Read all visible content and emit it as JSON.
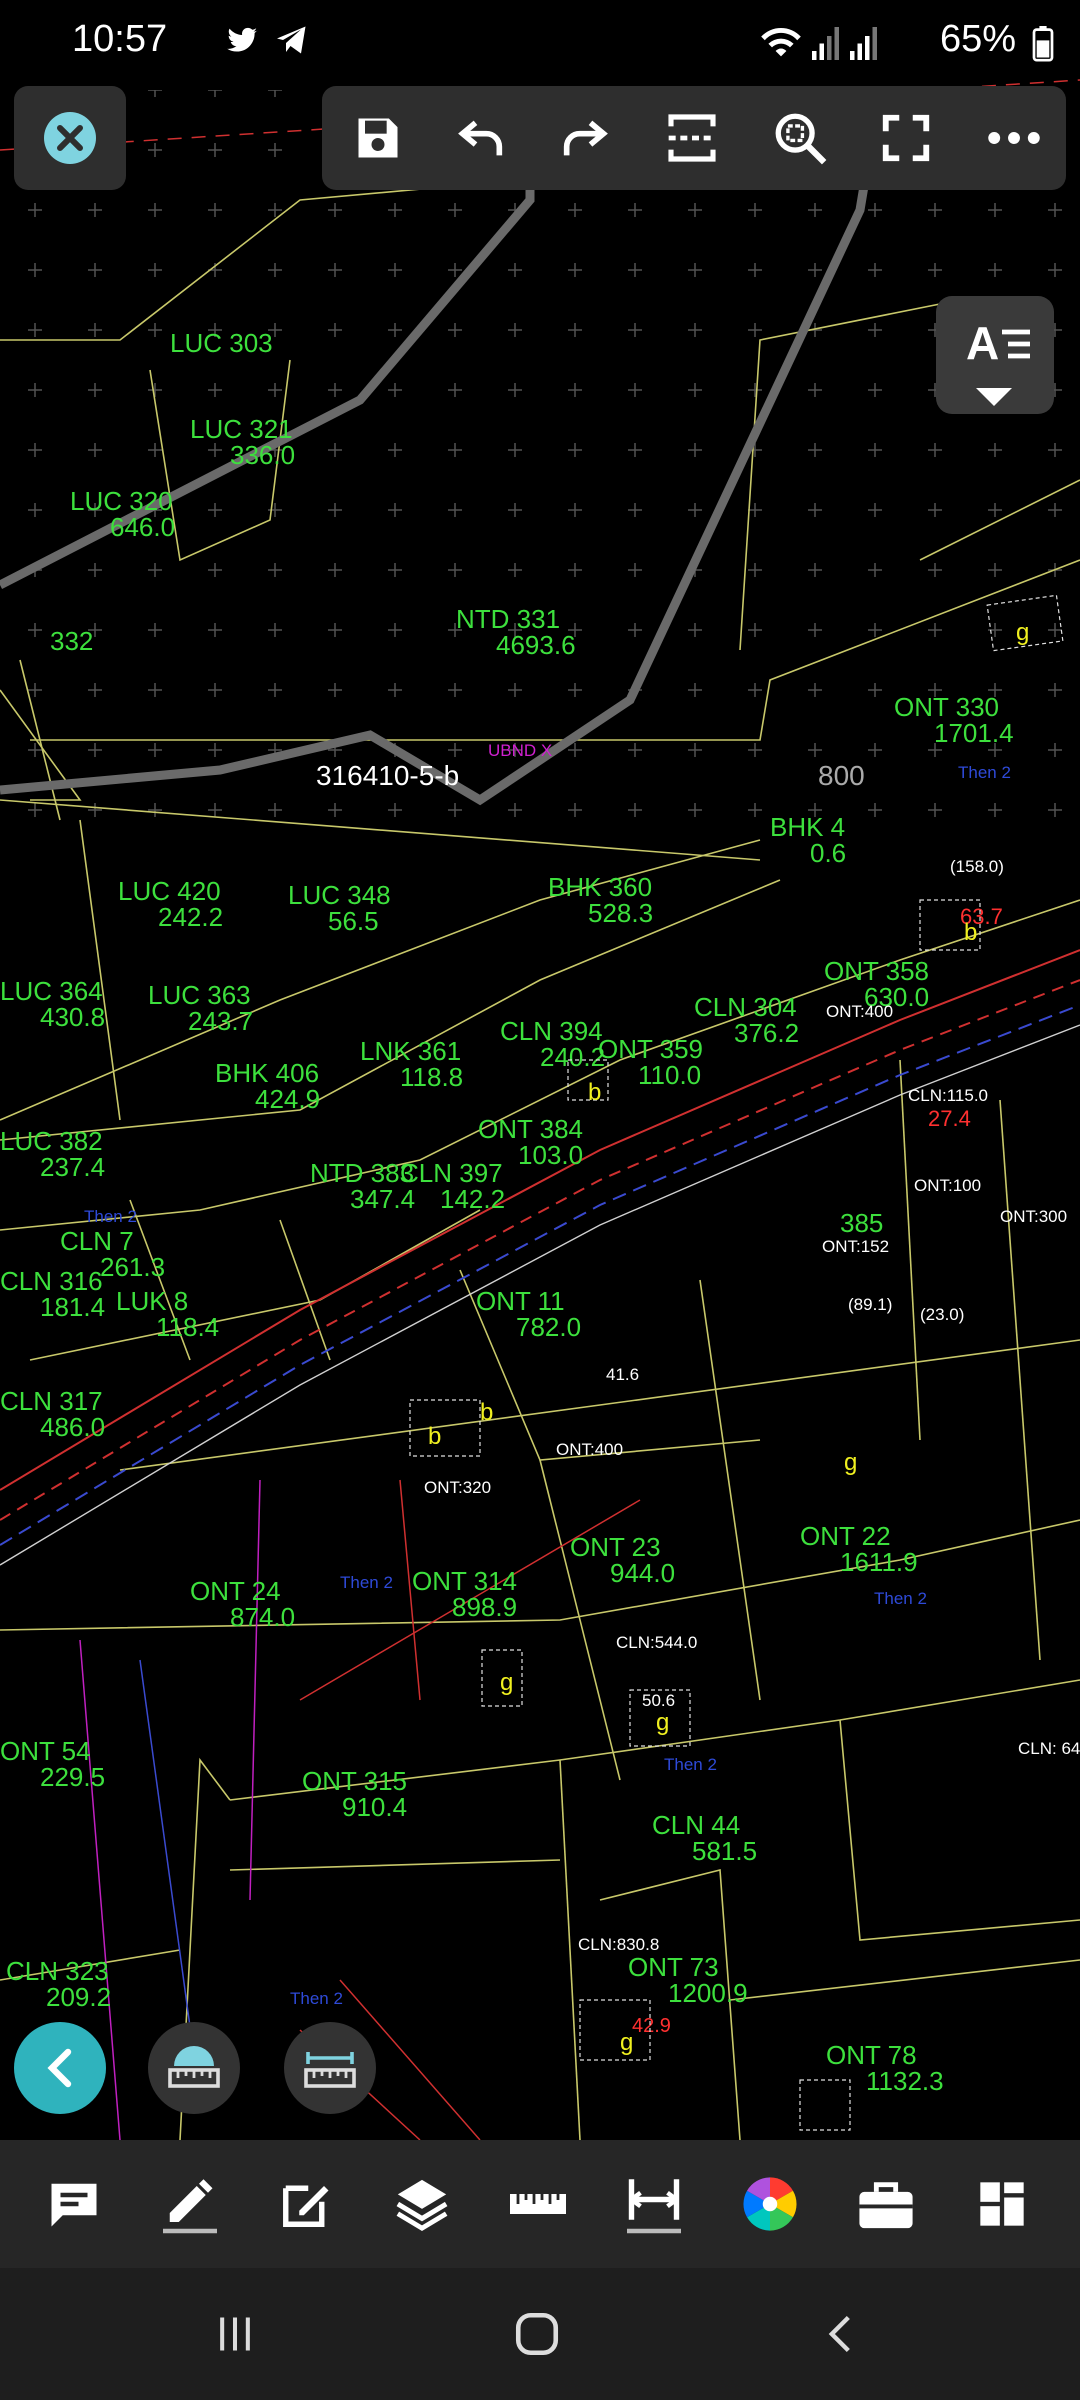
{
  "status_bar": {
    "time": "10:57",
    "battery": "65%",
    "icons": [
      "twitter-icon",
      "telegram-icon",
      "wifi-icon",
      "signal-icon",
      "signal-icon",
      "battery-icon"
    ]
  },
  "toolbar": {
    "close_icon": "close-icon",
    "icons": [
      "save-icon",
      "undo-icon",
      "redo-icon",
      "zoom-extents-icon",
      "zoom-window-icon",
      "fullscreen-icon",
      "more-icon"
    ]
  },
  "text_style_button": {
    "label": "A"
  },
  "map": {
    "drawing_id": "316410-5-b",
    "parcels": [
      {
        "type": "LUC",
        "number": "303",
        "area": ""
      },
      {
        "type": "LUC",
        "number": "321",
        "area": "336.0"
      },
      {
        "type": "LUC",
        "number": "320",
        "area": "646.0"
      },
      {
        "type": "NTD",
        "number": "331",
        "area": "4693.6"
      },
      {
        "type": "",
        "number": "332",
        "area": ""
      },
      {
        "type": "ONT",
        "number": "330",
        "area": "1701.4"
      },
      {
        "type": "BHK",
        "number": "360",
        "area": "528.3"
      },
      {
        "type": "BHK",
        "number": "4",
        "area": "0.6"
      },
      {
        "type": "LUC",
        "number": "420",
        "area": "242.2"
      },
      {
        "type": "LUC",
        "number": "348",
        "area": "56.5"
      },
      {
        "type": "LUC",
        "number": "363",
        "area": "243.7"
      },
      {
        "type": "LUC",
        "number": "364",
        "area": "430.8"
      },
      {
        "type": "BHK",
        "number": "406",
        "area": "424.9"
      },
      {
        "type": "LNK",
        "number": "361",
        "area": "118.8"
      },
      {
        "type": "CLN",
        "number": "394",
        "area": "240.2"
      },
      {
        "type": "ONT",
        "number": "359",
        "area": "110.0"
      },
      {
        "type": "CLN",
        "number": "304",
        "area": "376.2"
      },
      {
        "type": "ONT",
        "number": "358",
        "area": "630.0"
      },
      {
        "type": "LUC",
        "number": "382",
        "area": "237.4"
      },
      {
        "type": "ONT",
        "number": "384",
        "area": "103.0"
      },
      {
        "type": "NTD",
        "number": "383",
        "area": "347.4"
      },
      {
        "type": "CLN",
        "number": "397",
        "area": "142.2"
      },
      {
        "type": "CLN",
        "number": "7",
        "area": "261.3"
      },
      {
        "type": "LUK",
        "number": "8",
        "area": "118.4"
      },
      {
        "type": "CLN",
        "number": "316",
        "area": "181.4"
      },
      {
        "type": "CLN",
        "number": "317",
        "area": "486.0"
      },
      {
        "type": "ONT",
        "number": "11",
        "area": "782.0"
      },
      {
        "type": "",
        "number": "385",
        "area": ""
      },
      {
        "type": "ONT",
        "number": "24",
        "area": "874.0"
      },
      {
        "type": "ONT",
        "number": "314",
        "area": "898.9"
      },
      {
        "type": "ONT",
        "number": "23",
        "area": "944.0"
      },
      {
        "type": "ONT",
        "number": "22",
        "area": "1611.9"
      },
      {
        "type": "ONT",
        "number": "54",
        "area": "229.5"
      },
      {
        "type": "ONT",
        "number": "315",
        "area": "910.4"
      },
      {
        "type": "CLN",
        "number": "44",
        "area": "581.5"
      },
      {
        "type": "CLN",
        "number": "323",
        "area": "209.2"
      },
      {
        "type": "ONT",
        "number": "73",
        "area": "1200.9"
      },
      {
        "type": "ONT",
        "number": "78",
        "area": "1132.3"
      }
    ],
    "labels": {
      "scale_800": "800",
      "ubnd": "UBND X",
      "ont400_a": "ONT:400",
      "ont400_b": "ONT:400",
      "ont320": "ONT:320",
      "ont152": "ONT:152",
      "ont100": "ONT:100",
      "ont300": "ONT:300",
      "cln115": "CLN:115.0",
      "cln544": "CLN:544.0",
      "cln830": "CLN:830.8",
      "cln64": "CLN: 64",
      "red_637": "63.7",
      "red_274": "27.4",
      "red_429": "42.9",
      "small_1580": "(158.0)",
      "small_891": "(89.1)",
      "small_230": "(23.0)",
      "area_416": "41.6",
      "area_506": "50.6",
      "then2": "Then 2"
    }
  },
  "fabs": {
    "back_icon": "chevron-left-icon",
    "measure_icon": "area-measure-icon",
    "dim_icon": "distance-measure-icon"
  },
  "bottom_toolbar": {
    "icons": [
      "comment-icon",
      "pencil-icon",
      "edit-icon",
      "layers-icon",
      "ruler-icon",
      "dimension-icon",
      "color-wheel-icon",
      "toolbox-icon",
      "grid-icon"
    ]
  },
  "nav_bar": {
    "icons": [
      "recent-apps-icon",
      "home-icon",
      "back-icon"
    ]
  }
}
